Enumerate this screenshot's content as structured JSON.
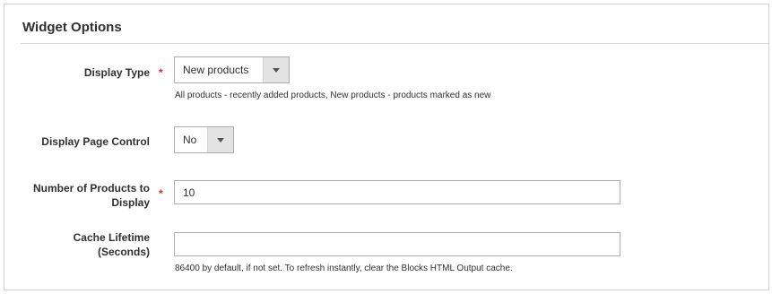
{
  "section": {
    "title": "Widget Options"
  },
  "fields": {
    "display_type": {
      "label": "Display Type",
      "required_mark": "*",
      "value": "New products",
      "note": "All products - recently added products, New products - products marked as new"
    },
    "page_control": {
      "label": "Display Page Control",
      "value": "No"
    },
    "num_products": {
      "label_line1": "Number of Products to",
      "label_line2": "Display",
      "required_mark": "*",
      "value": "10"
    },
    "cache_lifetime": {
      "label_line1": "Cache Lifetime",
      "label_line2": "(Seconds)",
      "value": "",
      "note": "86400 by default, if not set. To refresh instantly, clear the Blocks HTML Output cache."
    }
  }
}
